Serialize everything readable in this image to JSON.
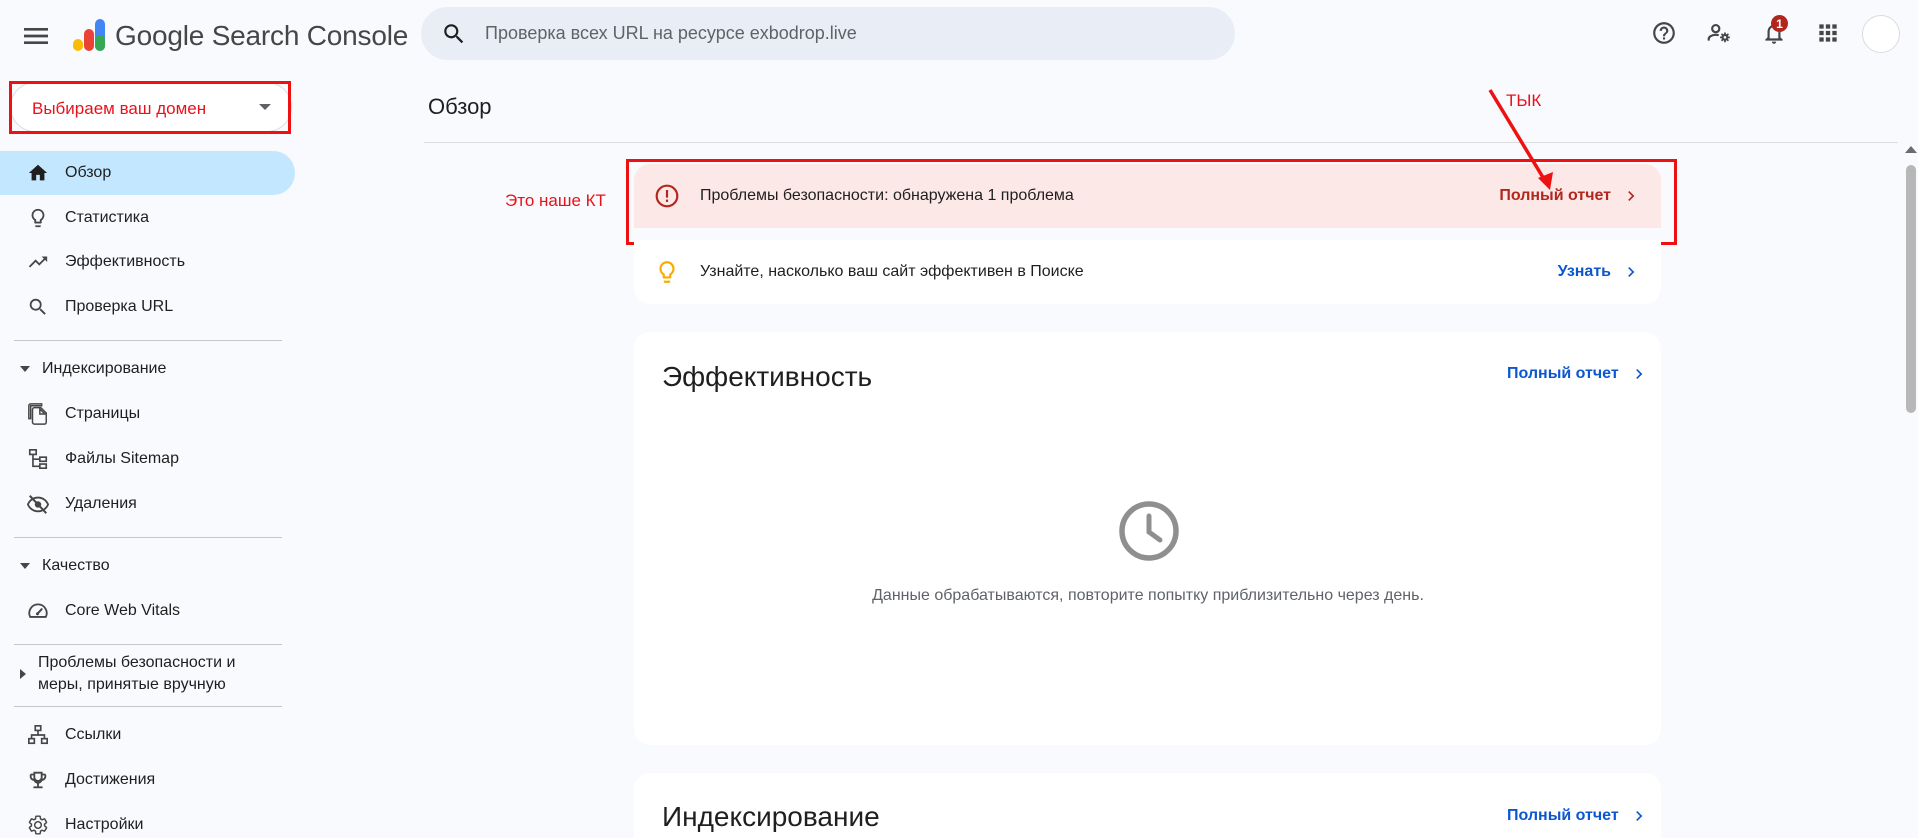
{
  "app": {
    "title_word1": "Google",
    "title_word2": "Search Console"
  },
  "search": {
    "placeholder": "Проверка всех URL на ресурсе exbodrop.live",
    "value": ""
  },
  "toolbar": {
    "help_icon": "help-circle-icon",
    "users_icon": "manage-users-icon",
    "notifications_icon": "bell-icon",
    "notifications_count": "1",
    "apps_icon": "apps-grid-icon"
  },
  "property_selector": {
    "label": "Выбираем ваш домен"
  },
  "sidebar": {
    "items": [
      {
        "label": "Обзор",
        "icon": "home-icon",
        "active": true
      },
      {
        "label": "Статистика",
        "icon": "lightbulb-icon"
      },
      {
        "label": "Эффективность",
        "icon": "trending-up-icon"
      },
      {
        "label": "Проверка URL",
        "icon": "search-icon"
      }
    ],
    "sections": [
      {
        "label": "Индексирование",
        "items": [
          {
            "label": "Страницы",
            "icon": "pages-icon"
          },
          {
            "label": "Файлы Sitemap",
            "icon": "sitemap-icon"
          },
          {
            "label": "Удаления",
            "icon": "eye-off-icon"
          }
        ]
      },
      {
        "label": "Качество",
        "items": [
          {
            "label": "Core Web Vitals",
            "icon": "speedometer-icon"
          }
        ]
      },
      {
        "label_line1": "Проблемы безопасности и",
        "label_line2": "меры, принятые вручную"
      }
    ],
    "bottom_items": [
      {
        "label": "Ссылки",
        "icon": "links-icon"
      },
      {
        "label": "Достижения",
        "icon": "trophy-icon"
      },
      {
        "label": "Настройки",
        "icon": "settings-icon"
      }
    ]
  },
  "main": {
    "page_title": "Обзор",
    "alert": {
      "text": "Проблемы безопасности: обнаружена 1 проблема",
      "link": "Полный отчет",
      "color": "#b3261e",
      "bg": "#fce8e6"
    },
    "tip": {
      "text": "Узнайте, насколько ваш сайт эффективен в Поиске",
      "link": "Узнать",
      "icon_color": "#f9ab00"
    },
    "performance": {
      "title": "Эффективность",
      "link": "Полный отчет",
      "message": "Данные обрабатываются, повторите попытку приблизительно через день."
    },
    "indexing": {
      "title": "Индексирование",
      "link": "Полный отчет"
    }
  },
  "annotations": {
    "kt_label": "Это наше КТ",
    "tyk_label": "ТЫК",
    "color": "#e8121b"
  },
  "colors": {
    "link_blue": "#0b57d0",
    "active_nav_bg": "#c2e7ff",
    "search_bg": "#e9eef6",
    "page_bg": "#f8fafd"
  }
}
